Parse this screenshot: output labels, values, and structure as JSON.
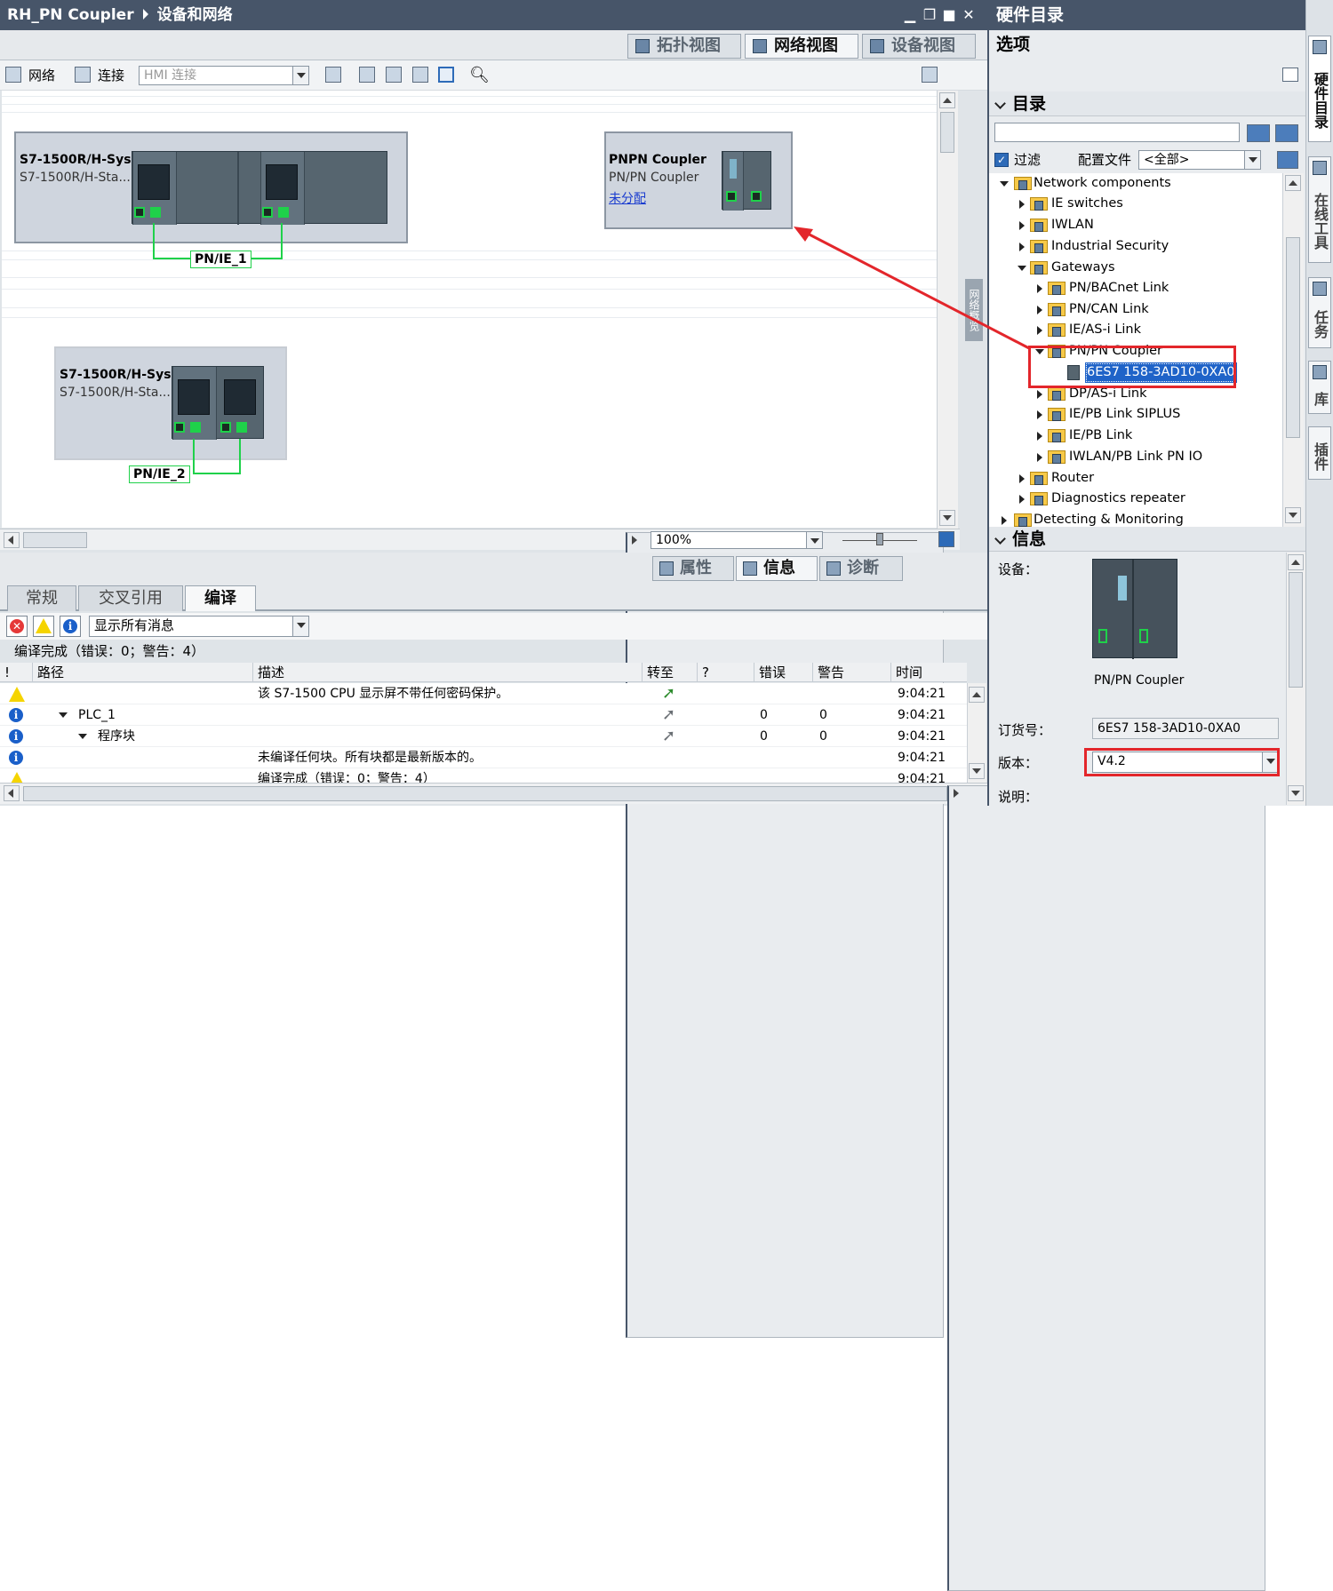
{
  "window": {
    "title": "RH_PN Coupler",
    "breadcrumb": "设备和网络"
  },
  "view_tabs": {
    "topology": "拓扑视图",
    "network": "网络视图",
    "device": "设备视图"
  },
  "toolbar": {
    "network_label": "网络",
    "connection_label": "连接",
    "connection_type": "HMI 连接"
  },
  "devices": [
    {
      "name": "S7-1500R/H-Sys...",
      "type": "S7-1500R/H-Sta..."
    },
    {
      "name": "PNPN Coupler",
      "type": "PN/PN Coupler",
      "status": "未分配"
    },
    {
      "name": "S7-1500R/H-Sys...",
      "type": "S7-1500R/H-Sta..."
    }
  ],
  "networks": [
    "PN/IE_1",
    "PN/IE_2"
  ],
  "side_tab_label": "网络概览",
  "zoom": "100%",
  "bottom_tabs": {
    "properties": "属性",
    "info": "信息",
    "diagnostics": "诊断"
  },
  "sub_tabs": [
    "常规",
    "交叉引用",
    "编译"
  ],
  "message_filter": "显示所有消息",
  "compile_status": "编译完成（错误：0；警告：4）",
  "columns": {
    "path": "路径",
    "description": "描述",
    "goto": "转至",
    "question": "?",
    "errors": "错误",
    "warnings": "警告",
    "time": "时间"
  },
  "messages": [
    {
      "type": "warning",
      "path": "",
      "description": "该 S7-1500 CPU 显示屏不带任何密码保护。",
      "errors": "",
      "warnings": "",
      "time": "9:04:21"
    },
    {
      "type": "info",
      "path": "PLC_1",
      "description": "",
      "errors": "0",
      "warnings": "0",
      "time": "9:04:21"
    },
    {
      "type": "info",
      "path": "程序块",
      "description": "",
      "errors": "0",
      "warnings": "0",
      "time": "9:04:21"
    },
    {
      "type": "info",
      "path": "",
      "description": "未编译任何块。所有块都是最新版本的。",
      "errors": "",
      "warnings": "",
      "time": "9:04:21"
    },
    {
      "type": "warning",
      "path": "",
      "description": "编译完成（错误：0；警告：4）",
      "errors": "",
      "warnings": "",
      "time": "9:04:21"
    }
  ],
  "catalog": {
    "title": "硬件目录",
    "options_label": "选项",
    "catalog_label": "目录",
    "filter_label": "过滤",
    "profile_label": "配置文件",
    "profile_value": "<全部>",
    "tree": [
      {
        "label": "Network components",
        "level": 0,
        "expanded": true
      },
      {
        "label": "IE switches",
        "level": 1
      },
      {
        "label": "IWLAN",
        "level": 1
      },
      {
        "label": "Industrial Security",
        "level": 1
      },
      {
        "label": "Gateways",
        "level": 1,
        "expanded": true
      },
      {
        "label": "PN/BACnet Link",
        "level": 2
      },
      {
        "label": "PN/CAN Link",
        "level": 2
      },
      {
        "label": "IE/AS-i Link",
        "level": 2
      },
      {
        "label": "PN/PN Coupler",
        "level": 2,
        "expanded": true
      },
      {
        "label": "6ES7 158-3AD10-0XA0",
        "level": 3,
        "selected": true
      },
      {
        "label": "DP/AS-i Link",
        "level": 2
      },
      {
        "label": "IE/PB Link SIPLUS",
        "level": 2
      },
      {
        "label": "IE/PB Link",
        "level": 2
      },
      {
        "label": "IWLAN/PB Link PN IO",
        "level": 2
      },
      {
        "label": "Router",
        "level": 1
      },
      {
        "label": "Diagnostics repeater",
        "level": 1
      },
      {
        "label": "Detecting & Monitoring",
        "level": 0
      }
    ]
  },
  "info_panel": {
    "title": "信息",
    "device_label": "设备：",
    "device_name": "PN/PN Coupler",
    "order_label": "订货号：",
    "order_number": "6ES7 158-3AD10-0XA0",
    "version_label": "版本：",
    "version": "V4.2",
    "description_label": "说明："
  },
  "sidebar_tabs": [
    "硬件目录",
    "在线工具",
    "任务",
    "库",
    "插件"
  ],
  "colors": {
    "titlebar": "#475569",
    "network_green": "#1fd14a",
    "highlight_red": "#e3262b",
    "selection_blue": "#1f63c8"
  }
}
